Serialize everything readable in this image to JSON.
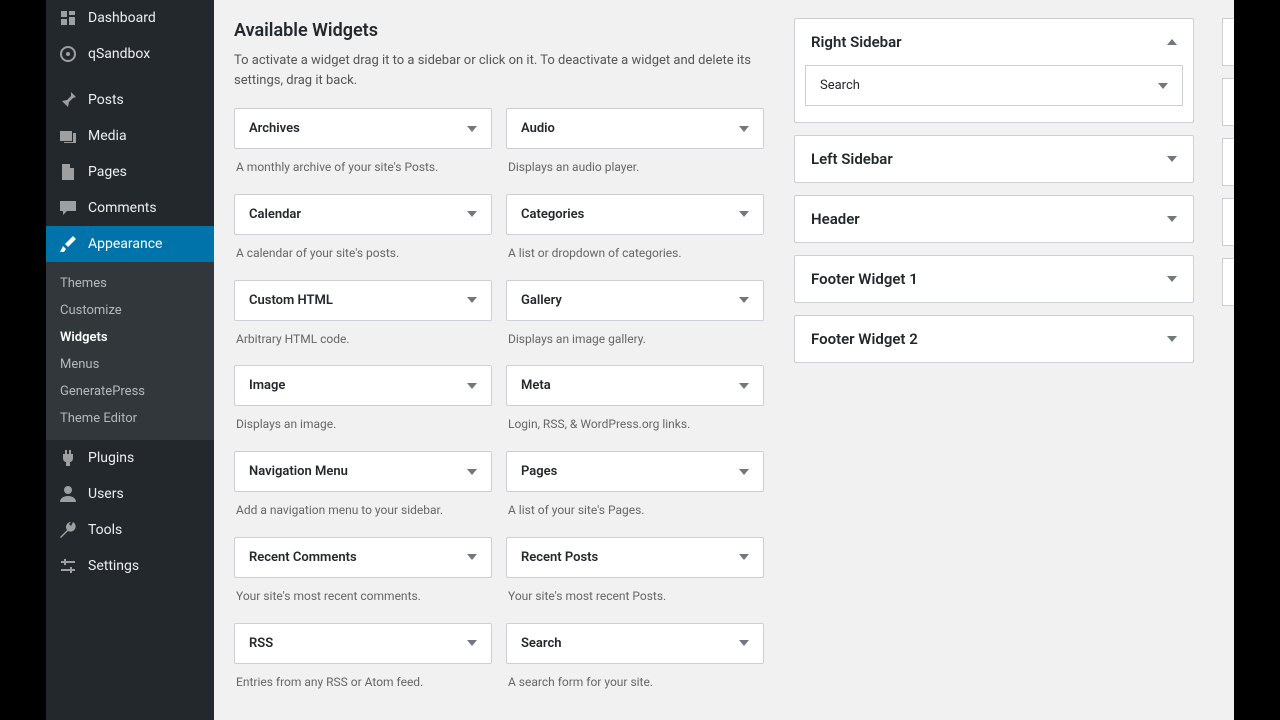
{
  "sidebar": {
    "items": [
      {
        "label": "Dashboard",
        "icon": "dashboard"
      },
      {
        "label": "qSandbox",
        "icon": "sandbox"
      },
      {
        "label": "Posts",
        "icon": "pin"
      },
      {
        "label": "Media",
        "icon": "media"
      },
      {
        "label": "Pages",
        "icon": "page"
      },
      {
        "label": "Comments",
        "icon": "comment"
      },
      {
        "label": "Appearance",
        "icon": "brush",
        "active": true
      },
      {
        "label": "Plugins",
        "icon": "plugin"
      },
      {
        "label": "Users",
        "icon": "user"
      },
      {
        "label": "Tools",
        "icon": "tool"
      },
      {
        "label": "Settings",
        "icon": "settings"
      }
    ],
    "submenu": [
      {
        "label": "Themes"
      },
      {
        "label": "Customize"
      },
      {
        "label": "Widgets",
        "current": true
      },
      {
        "label": "Menus"
      },
      {
        "label": "GeneratePress"
      },
      {
        "label": "Theme Editor"
      }
    ]
  },
  "available": {
    "title": "Available Widgets",
    "desc": "To activate a widget drag it to a sidebar or click on it. To deactivate a widget and delete its settings, drag it back.",
    "widgets": [
      {
        "name": "Archives",
        "desc": "A monthly archive of your site's Posts."
      },
      {
        "name": "Audio",
        "desc": "Displays an audio player."
      },
      {
        "name": "Calendar",
        "desc": "A calendar of your site's posts."
      },
      {
        "name": "Categories",
        "desc": "A list or dropdown of categories."
      },
      {
        "name": "Custom HTML",
        "desc": "Arbitrary HTML code."
      },
      {
        "name": "Gallery",
        "desc": "Displays an image gallery."
      },
      {
        "name": "Image",
        "desc": "Displays an image."
      },
      {
        "name": "Meta",
        "desc": "Login, RSS, & WordPress.org links."
      },
      {
        "name": "Navigation Menu",
        "desc": "Add a navigation menu to your sidebar."
      },
      {
        "name": "Pages",
        "desc": "A list of your site's Pages."
      },
      {
        "name": "Recent Comments",
        "desc": "Your site's most recent comments."
      },
      {
        "name": "Recent Posts",
        "desc": "Your site's most recent Posts."
      },
      {
        "name": "RSS",
        "desc": "Entries from any RSS or Atom feed."
      },
      {
        "name": "Search",
        "desc": "A search form for your site."
      }
    ]
  },
  "areas": [
    {
      "title": "Right Sidebar",
      "open": true,
      "widgets": [
        "Search"
      ]
    },
    {
      "title": "Left Sidebar",
      "open": false
    },
    {
      "title": "Header",
      "open": false
    },
    {
      "title": "Footer Widget 1",
      "open": false
    },
    {
      "title": "Footer Widget 2",
      "open": false
    }
  ]
}
